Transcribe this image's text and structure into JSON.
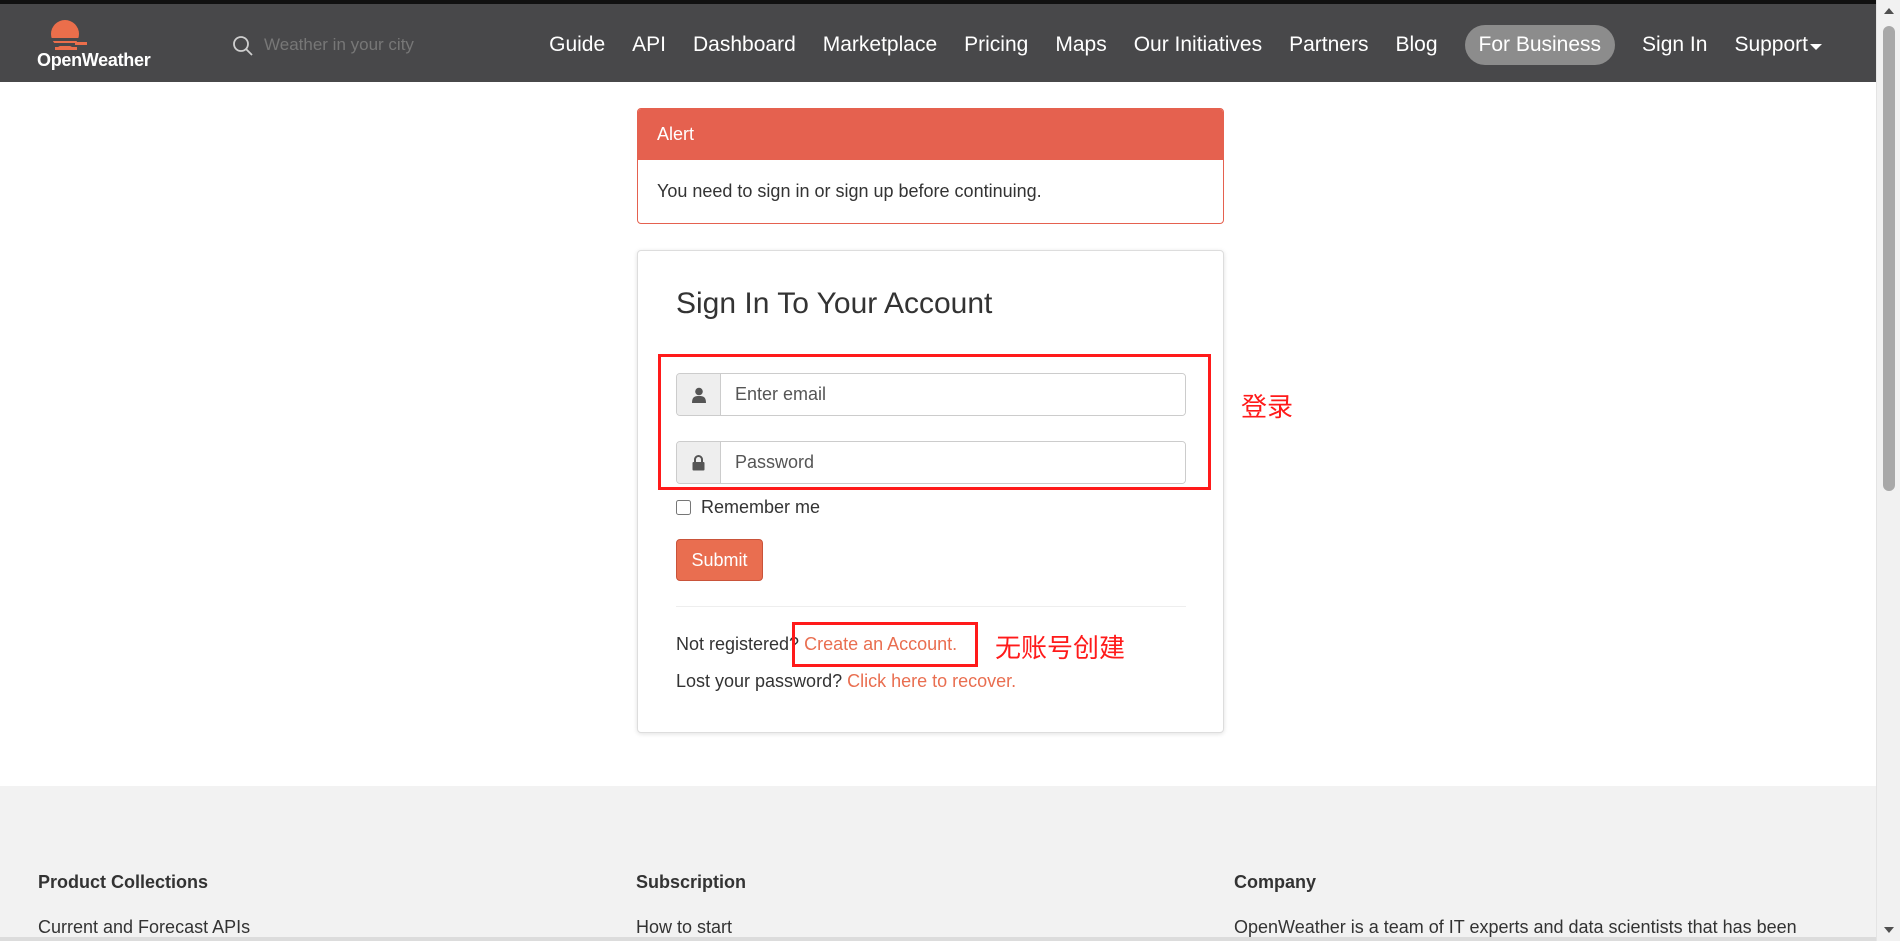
{
  "nav": {
    "logo_text": "OpenWeather",
    "search_placeholder": "Weather in your city",
    "links": [
      "Guide",
      "API",
      "Dashboard",
      "Marketplace",
      "Pricing",
      "Maps",
      "Our Initiatives",
      "Partners",
      "Blog"
    ],
    "for_business": "For Business",
    "sign_in": "Sign In",
    "support": "Support"
  },
  "alert": {
    "title": "Alert",
    "message": "You need to sign in or sign up before continuing."
  },
  "signin": {
    "heading": "Sign In To Your Account",
    "email_placeholder": "Enter email",
    "password_placeholder": "Password",
    "remember_label": "Remember me",
    "submit_label": "Submit",
    "not_registered": "Not registered?",
    "create_account": "Create an Account.",
    "lost_password": "Lost your password?",
    "recover": "Click here to recover."
  },
  "annotations": {
    "login_label": "登录",
    "create_label": "无账号创建"
  },
  "footer": {
    "col1_title": "Product Collections",
    "col1_item": "Current and Forecast APIs",
    "col2_title": "Subscription",
    "col2_item": "How to start",
    "col3_title": "Company",
    "col3_item": "OpenWeather is a team of IT experts and data scientists that has been"
  },
  "colors": {
    "navbar": "#48484a",
    "accent": "#e96e50",
    "alert": "#e5614f",
    "annotation": "#ff1a1a"
  }
}
